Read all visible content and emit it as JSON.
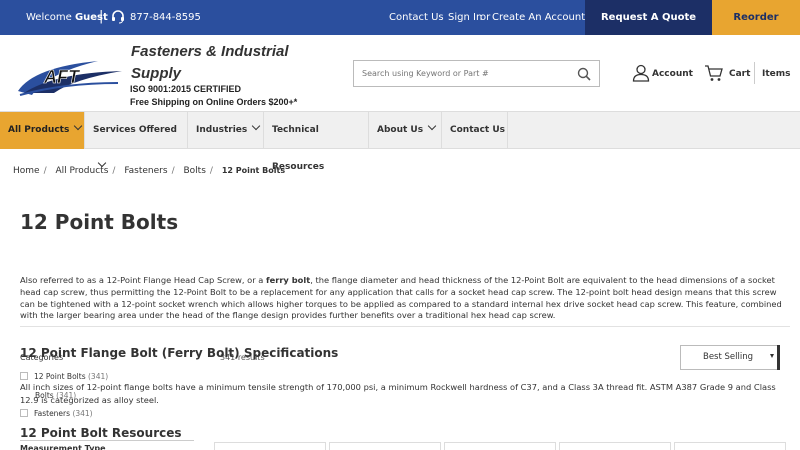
{
  "topbar": {
    "welcome": "Welcome",
    "user": "Guest",
    "separator": "|",
    "phone": "877-844-8595",
    "contact": "Contact Us",
    "sign_in": "Sign In",
    "or": "or",
    "create_account": "Create An Account",
    "request_quote": "Request A Quote",
    "reorder": "Reorder"
  },
  "header": {
    "logo_text": "AFT",
    "brand_line1": "Fasteners & Industrial",
    "brand_line2": "Supply",
    "certification": "ISO 9001:2015 CERTIFIED",
    "shipping": "Free Shipping on Online Orders $200+*",
    "search_placeholder": "Search using Keyword or Part #",
    "account": "Account",
    "cart": "Cart",
    "items": "Items"
  },
  "nav": {
    "items": [
      {
        "label": "All Products",
        "dropdown": true,
        "active": true
      },
      {
        "label": "Services Offered",
        "dropdown": true
      },
      {
        "label": "Industries",
        "dropdown": true
      },
      {
        "label": "Technical Resources",
        "dropdown": false
      },
      {
        "label": "About Us",
        "dropdown": true
      },
      {
        "label": "Contact Us",
        "dropdown": false
      }
    ]
  },
  "breadcrumb": [
    "Home",
    "All Products",
    "Fasteners",
    "Bolts",
    "12 Point Bolts"
  ],
  "page": {
    "title": "12 Point Bolts",
    "intro_before": "Also referred to as a 12-Point Flange Head Cap Screw, or a ",
    "intro_bold": "ferry bolt",
    "intro_after": ", the flange diameter and head thickness of the 12-Point Bolt are equivalent to the head dimensions of a socket head cap screw, thus permitting the 12-Point Bolt to be a replacement for any application that calls for a socket head cap screw. The 12-point bolt head design means that this screw can be tightened with a 12-point socket wrench which allows higher torques to be applied as compared to a standard internal hex drive socket head cap screw. This feature, combined with the larger bearing area under the head of the flange design provides further benefits over a traditional hex head cap screw.",
    "spec_heading": "12 Point Flange Bolt (Ferry Bolt) Specifications",
    "spec_text": "All inch sizes of 12-point flange bolts have a minimum tensile strength of 170,000 psi, a minimum Rockwell hardness of C37, and a Class 3A thread fit. ASTM A387 Grade 9 and Class 12.9 is categorized as alloy steel.",
    "resources_heading": "12 Point Bolt Resources"
  },
  "filters": {
    "heading": "Categories",
    "results": "341 results",
    "sort_selected": "Best Selling",
    "categories": [
      {
        "label": "12 Point Bolts",
        "count": "(341)"
      },
      {
        "label": "Bolts",
        "count": "(341)"
      },
      {
        "label": "Fasteners",
        "count": "(341)"
      }
    ],
    "measurement_type": "Measurement Type"
  },
  "colors": {
    "topbar": "#2b4f9e",
    "quote_button": "#1c2f66",
    "reorder_button": "#e8a530",
    "nav_active": "#e8a530"
  }
}
